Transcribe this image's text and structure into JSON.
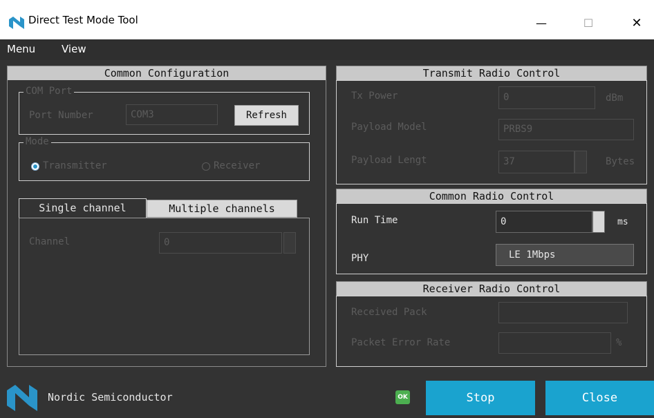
{
  "window": {
    "title": "Direct Test Mode Tool",
    "minimize": "—",
    "maximize": "☐",
    "close": "✕"
  },
  "menu": {
    "items": [
      "Menu",
      "View"
    ]
  },
  "common_config": {
    "title": "Common Configuration",
    "com_port": {
      "group_title": "COM Port",
      "label": "Port Number",
      "value": "COM3",
      "refresh": "Refresh"
    },
    "mode": {
      "group_title": "Mode",
      "options": [
        "Transmitter",
        "Receiver"
      ],
      "selected": "Transmitter"
    },
    "tabs": [
      "Single channel",
      "Multiple channels"
    ],
    "active_tab": "Single channel",
    "channel": {
      "label": "Channel",
      "value": "0"
    }
  },
  "transmit": {
    "title": "Transmit Radio Control",
    "tx_power": {
      "label": "Tx Power",
      "value": "0",
      "unit": "dBm"
    },
    "payload_model": {
      "label": "Payload Model",
      "value": "PRBS9"
    },
    "payload_length": {
      "label": "Payload Lengt",
      "value": "37",
      "unit": "Bytes"
    }
  },
  "common_radio": {
    "title": "Common Radio Control",
    "run_time": {
      "label": "Run Time",
      "value": "0",
      "unit": "ms"
    },
    "phy": {
      "label": "PHY",
      "value": "LE 1Mbps"
    }
  },
  "receiver": {
    "title": "Receiver Radio Control",
    "received_packets": {
      "label": "Received Pack",
      "value": ""
    },
    "per": {
      "label": "Packet Error Rate",
      "value": "",
      "unit": "%"
    }
  },
  "footer": {
    "company": "Nordic Semiconductor",
    "status": "OK",
    "stop": "Stop",
    "close": "Close"
  },
  "colors": {
    "accent": "#1aa3cf",
    "ok_badge": "#4caf50",
    "panel_header": "#c9c9c9"
  }
}
